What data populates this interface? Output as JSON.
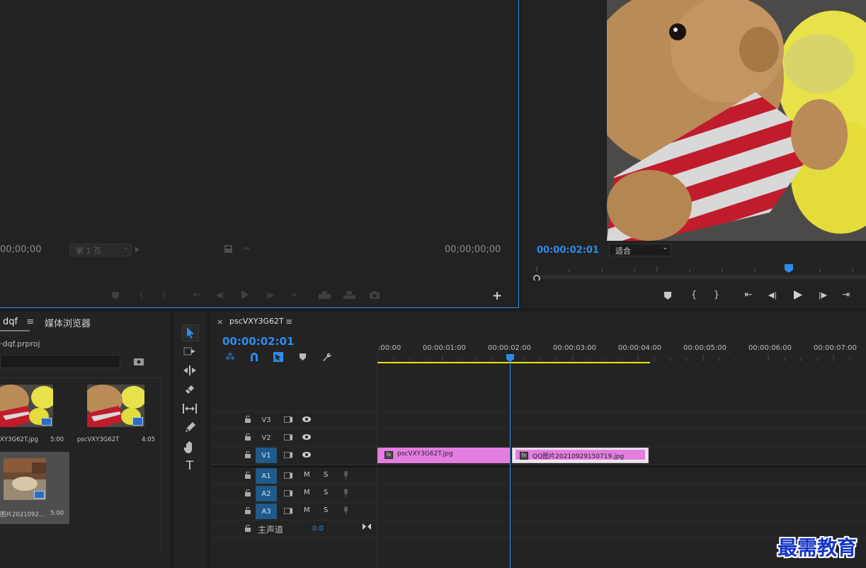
{
  "source_monitor": {
    "timecode_left": "00;00;00",
    "page_select": "第 1 页",
    "timecode_right": "00;00;00;00"
  },
  "program_monitor": {
    "timecode": "00:00:02:01",
    "fit_select": "适合"
  },
  "project_panel": {
    "tab_project": "dqf",
    "tab_media_browser": "媒体浏览器",
    "project_file": "dqf.prproj",
    "items": [
      {
        "name": "XY3G62T.jpg",
        "duration": "5:00"
      },
      {
        "name": "pscVXY3G62T",
        "duration": "4:05"
      },
      {
        "name": "图片2021092...",
        "duration": "5:00"
      }
    ]
  },
  "timeline": {
    "sequence_tab": "pscVXY3G62T",
    "close_glyph": "×",
    "menu_glyph": "≡",
    "timecode": "00:00:02:01",
    "ruler_labels": [
      ":00:00",
      "00:00:01:00",
      "00:00:02:00",
      "00:00:03:00",
      "00:00:04:00",
      "00:00:05:00",
      "00:00:06:00",
      "00:00:07:00"
    ],
    "video_tracks": [
      "V3",
      "V2",
      "V1"
    ],
    "audio_tracks": [
      "A1",
      "A2",
      "A3"
    ],
    "mute_label": "M",
    "solo_label": "S",
    "master": {
      "label": "主声道",
      "value": "0.0"
    },
    "clips": [
      {
        "name": "pscVXY3G62T.jpg",
        "fx": "fx"
      },
      {
        "name": "QQ图片20210929150719.jpg",
        "fx": "fx"
      }
    ]
  },
  "watermark": "最需教育",
  "colors": {
    "accent_blue": "#2d8ceb",
    "clip_pink": "#e27ee0",
    "work_area_yellow": "#e6e600",
    "track_target_blue": "#1f5a8a"
  }
}
